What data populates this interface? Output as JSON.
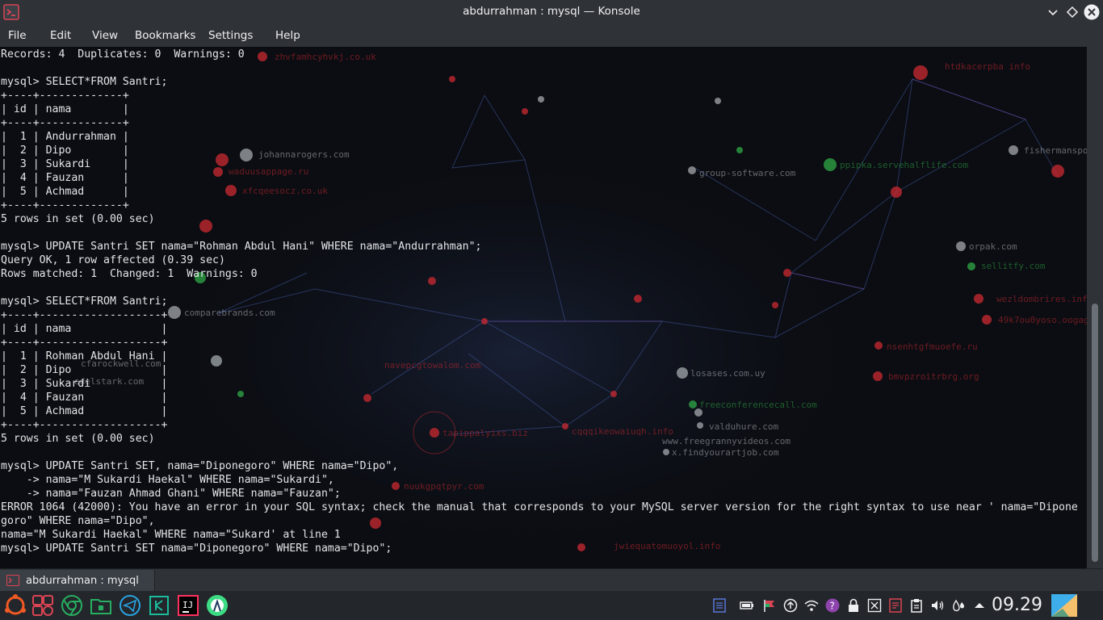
{
  "window": {
    "title": "abdurrahman : mysql — Konsole"
  },
  "menu": [
    "File",
    "Edit",
    "View",
    "Bookmarks",
    "Settings",
    "Help"
  ],
  "terminal_lines": [
    "Records: 4  Duplicates: 0  Warnings: 0",
    "",
    "mysql> SELECT*FROM Santri;",
    "+----+-------------+",
    "| id | nama        |",
    "+----+-------------+",
    "|  1 | Andurrahman |",
    "|  2 | Dipo        |",
    "|  3 | Sukardi     |",
    "|  4 | Fauzan      |",
    "|  5 | Achmad      |",
    "+----+-------------+",
    "5 rows in set (0.00 sec)",
    "",
    "mysql> UPDATE Santri SET nama=\"Rohman Abdul Hani\" WHERE nama=\"Andurrahman\";",
    "Query OK, 1 row affected (0.39 sec)",
    "Rows matched: 1  Changed: 1  Warnings: 0",
    "",
    "mysql> SELECT*FROM Santri;",
    "+----+-------------------+",
    "| id | nama              |",
    "+----+-------------------+",
    "|  1 | Rohman Abdul Hani |",
    "|  2 | Dipo              |",
    "|  3 | Sukardi           |",
    "|  4 | Fauzan            |",
    "|  5 | Achmad            |",
    "+----+-------------------+",
    "5 rows in set (0.00 sec)",
    "",
    "mysql> UPDATE Santri SET, nama=\"Diponegoro\" WHERE nama=\"Dipo\",",
    "    -> nama=\"M Sukardi Haekal\" WHERE nama=\"Sukardi\",",
    "    -> nama=\"Fauzan Ahmad Ghani\" WHERE nama=\"Fauzan\";",
    "ERROR 1064 (42000): You have an error in your SQL syntax; check the manual that corresponds to your MySQL server version for the right syntax to use near ' nama=\"Dipone",
    "goro\" WHERE nama=\"Dipo\",",
    "nama=\"M Sukardi Haekal\" WHERE nama=\"Sukard' at line 1",
    "mysql> UPDATE Santri SET nama=\"Diponegoro\" WHERE nama=\"Dipo\";"
  ],
  "tab": {
    "label": "abdurrahman : mysql"
  },
  "taskbar": {
    "apps": [
      "application-launcher-icon",
      "multitasking-icon",
      "chrome-icon",
      "file-manager-icon",
      "telegram-icon",
      "kde-connect-icon",
      "intellij-icon",
      "android-studio-icon"
    ],
    "tray": [
      "clipboard-icon",
      "battery-icon",
      "flag-icon",
      "update-icon",
      "wifi-icon",
      "help-icon",
      "lock-icon",
      "screen-close-icon",
      "notes-icon",
      "paste-icon",
      "volume-icon",
      "drops-icon",
      "tray-expand-icon"
    ],
    "clock": "09.29"
  },
  "colors": {
    "chrome_bg": "#2f3338",
    "terminal_bg": "#0b0d12",
    "text": "#e3e6e8",
    "close_button": "#eff0f1",
    "accent_red": "#da4453"
  }
}
